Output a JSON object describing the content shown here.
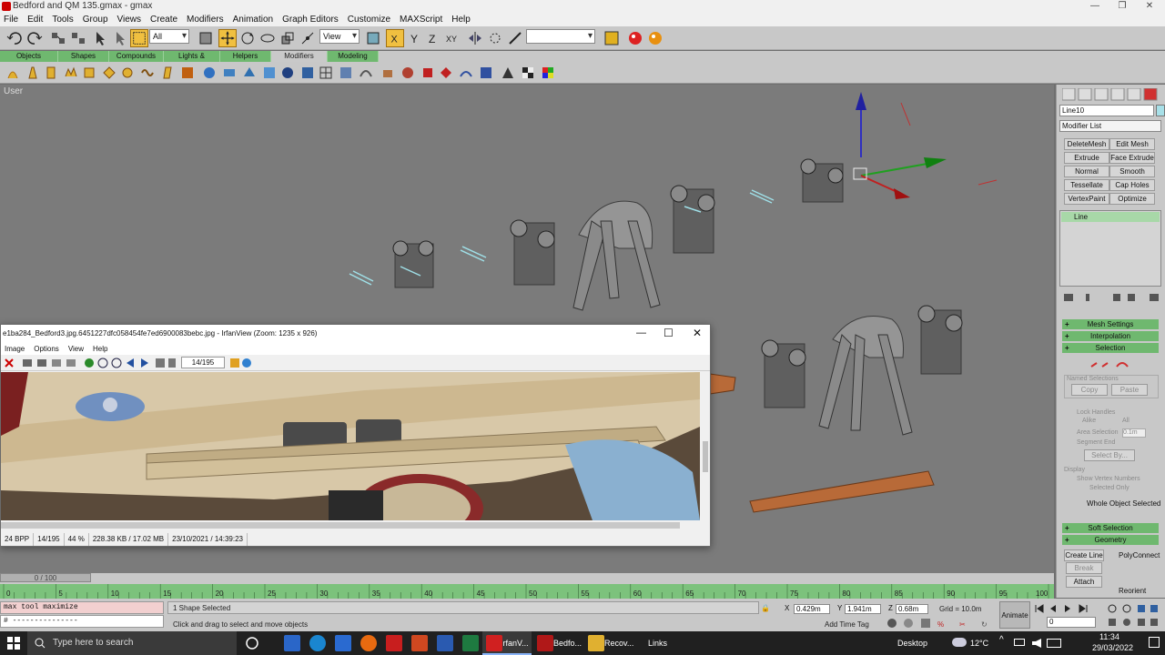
{
  "window": {
    "title": "Bedford and QM 135.gmax - gmax",
    "minimize": "—",
    "maximize": "❐",
    "close": "✕"
  },
  "menu": [
    "File",
    "Edit",
    "Tools",
    "Group",
    "Views",
    "Create",
    "Modifiers",
    "Animation",
    "Graph Editors",
    "Customize",
    "MAXScript",
    "Help"
  ],
  "toolbar": {
    "selection_filter": "All",
    "ref_coord": "View",
    "named_sel": ""
  },
  "tabs": [
    "Objects",
    "Shapes",
    "Compounds",
    "Lights & Cameras",
    "Helpers",
    "Modifiers",
    "Modeling"
  ],
  "viewport": {
    "label": "User"
  },
  "command_panel": {
    "object_name": "Line10",
    "modifier_list": "Modifier List",
    "buttons": [
      "DeleteMesh",
      "Edit Mesh",
      "Extrude",
      "Face Extrude",
      "Normal",
      "Smooth",
      "Tessellate",
      "Cap Holes",
      "VertexPaint",
      "Optimize"
    ],
    "stack_item": "Line",
    "rollouts": {
      "mesh_settings": "Mesh Settings",
      "interpolation": "Interpolation",
      "selection": "Selection",
      "soft_selection": "Soft Selection",
      "geometry": "Geometry"
    },
    "named_selections": "Named Selections",
    "copy": "Copy",
    "paste": "Paste",
    "lock_handles": "Lock Handles",
    "alike": "Alike",
    "all": "All",
    "area_selection": "Area Selection",
    "area_value": "0.1m",
    "segment_end": "Segment End",
    "select_by": "Select By...",
    "display": "Display",
    "show_vertex_numbers": "Show Vertex Numbers",
    "selected_only": "Selected Only",
    "whole_object": "Whole Object Selected",
    "create_line": "Create Line",
    "polyconnect": "PolyConnect",
    "break": "Break",
    "attach": "Attach",
    "reorient": "Reorient"
  },
  "irfanview": {
    "title": "e1ba284_Bedford3.jpg.6451227dfc058454fe7ed6900083bebc.jpg - IrfanView (Zoom: 1235 x 926)",
    "menu": [
      "Image",
      "Options",
      "View",
      "Help"
    ],
    "page": "14/195",
    "status": [
      "24 BPP",
      "14/195",
      "44 %",
      "228.38 KB / 17.02 MB",
      "23/10/2021 / 14:39:23"
    ]
  },
  "timeline": {
    "slider": "0 / 100",
    "ticks": [
      "0",
      "5",
      "10",
      "15",
      "20",
      "25",
      "30",
      "35",
      "40",
      "45",
      "50",
      "55",
      "60",
      "65",
      "70",
      "75",
      "80",
      "85",
      "90",
      "95",
      "100"
    ]
  },
  "status": {
    "maxscript": "max tool maximize",
    "maxscript2": "# ---------------",
    "selection": "1 Shape Selected",
    "prompt": "Click and drag to select and move objects",
    "x": "0.429m",
    "y": "1.941m",
    "z": "0.68m",
    "grid": "Grid = 10.0m",
    "add_time_tag": "Add Time Tag",
    "animate": "Animate",
    "frame": "0"
  },
  "taskbar": {
    "search": "Type here to search",
    "apps": [
      "IrfanV...",
      "Bedfo...",
      "Recov..."
    ],
    "links": "Links",
    "desktop": "Desktop",
    "temp": "12°C",
    "time": "11:34",
    "date": "29/03/2022"
  },
  "colors": {
    "tab_green": "#6fb86f",
    "viewport": "#7b7b7b",
    "panel": "#c8c8c8",
    "taskbar": "#202020"
  }
}
